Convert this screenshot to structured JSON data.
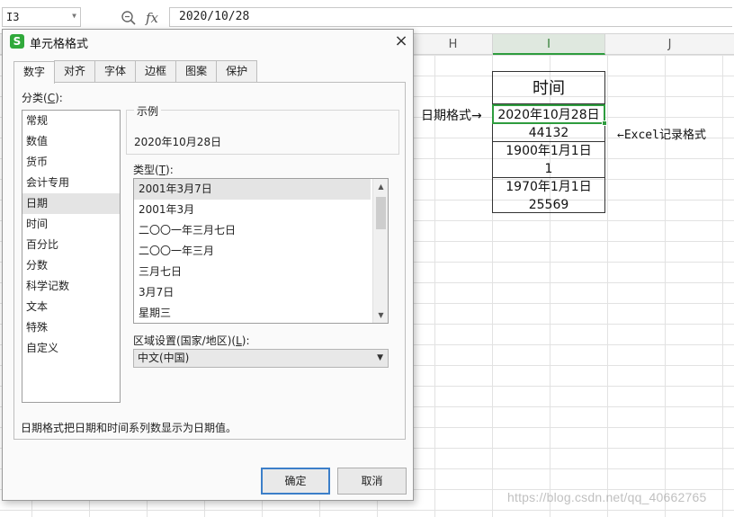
{
  "formula_bar": {
    "cell_ref": "I3",
    "formula_value": "2020/10/28",
    "fx_label": "fx"
  },
  "columns": {
    "h": "H",
    "i": "I",
    "j": "J"
  },
  "sheet": {
    "table_title": "时间",
    "rows": [
      "2020年10月28日",
      "44132",
      "1900年1月1日",
      "1",
      "1970年1月1日",
      "25569"
    ],
    "left_annotation": "日期格式→",
    "right_annotation": "←Excel记录格式"
  },
  "watermark": "https://blog.csdn.net/qq_40662765",
  "dialog": {
    "title": "单元格格式",
    "close": "×",
    "tabs": [
      "数字",
      "对齐",
      "字体",
      "边框",
      "图案",
      "保护"
    ],
    "active_tab": 0,
    "category_label": "分类(",
    "category_key": "C",
    "category_label_end": "):",
    "categories": [
      "常规",
      "数值",
      "货币",
      "会计专用",
      "日期",
      "时间",
      "百分比",
      "分数",
      "科学记数",
      "文本",
      "特殊",
      "自定义"
    ],
    "selected_category": 4,
    "sample_label": "示例",
    "sample_value": "2020年10月28日",
    "type_label": "类型(",
    "type_key": "T",
    "type_label_end": "):",
    "types": [
      "2001年3月7日",
      "2001年3月",
      "二〇〇一年三月七日",
      "二〇〇一年三月",
      "三月七日",
      "3月7日",
      "星期三"
    ],
    "selected_type": 0,
    "region_label": "区域设置(国家/地区)(",
    "region_key": "L",
    "region_label_end": "):",
    "region_value": "中文(中国)",
    "description": "日期格式把日期和时间系列数显示为日期值。",
    "ok_label": "确定",
    "cancel_label": "取消"
  },
  "colors": {
    "accent": "#2e9c3e",
    "logo": "#30a93b",
    "focus": "#3c7fc9"
  }
}
